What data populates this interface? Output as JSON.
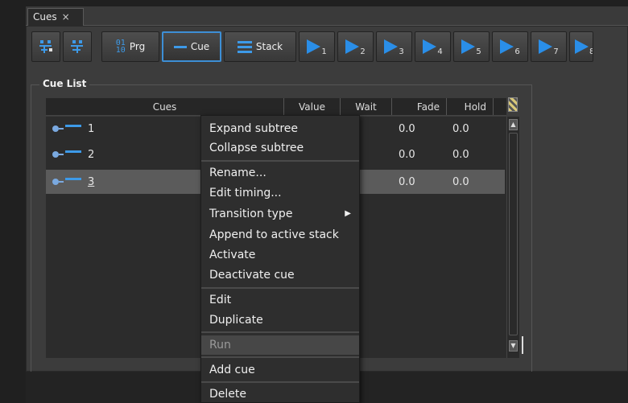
{
  "tab": {
    "label": "Cues",
    "close": "×"
  },
  "toolbar": {
    "prg_label": "Prg",
    "cue_label": "Cue",
    "stack_label": "Stack",
    "play_buttons": [
      "1",
      "2",
      "3",
      "4",
      "5",
      "6",
      "7",
      "8"
    ]
  },
  "cue_list": {
    "title": "Cue List",
    "columns": {
      "cues": "Cues",
      "value": "Value",
      "wait": "Wait",
      "fade": "Fade",
      "hold": "Hold"
    },
    "rows": [
      {
        "name": "1",
        "wait": ")",
        "fade": "0.0",
        "hold": "0.0"
      },
      {
        "name": "2",
        "wait": ")",
        "fade": "0.0",
        "hold": "0.0"
      },
      {
        "name": "3",
        "wait": ")",
        "fade": "0.0",
        "hold": "0.0"
      }
    ]
  },
  "context_menu": {
    "expand": "Expand subtree",
    "collapse": "Collapse subtree",
    "rename": "Rename...",
    "edit_timing": "Edit timing...",
    "transition": "Transition type",
    "append": "Append to active stack",
    "activate": "Activate",
    "deactivate": "Deactivate cue",
    "edit": "Edit",
    "duplicate": "Duplicate",
    "run": "Run",
    "add_cue": "Add cue",
    "delete": "Delete"
  }
}
